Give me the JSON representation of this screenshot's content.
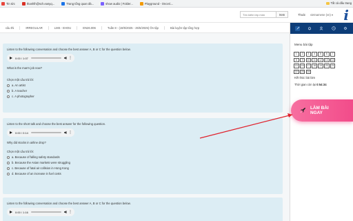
{
  "bookmarks": [
    {
      "label": "Tin tức",
      "color": "#e8453c"
    },
    {
      "label": "thanhlh@sch.easyq...",
      "color": "#d93025"
    },
    {
      "label": "Trang tổng quan đà...",
      "color": "#1a73e8"
    },
    {
      "label": "show audio | Folder...",
      "color": "#7b61ff"
    },
    {
      "label": "Playground - OnceC...",
      "color": "#f29900"
    }
  ],
  "bookmarks_right": "Tất cả dấu trang",
  "header": {
    "search_placeholder": "Tìm kiếm lớp môn",
    "search_button": "Xem",
    "logout": "Thoát",
    "user": "vietnamese (vn) ▾",
    "brand": "i"
  },
  "breadcrumb": [
    "câu thi",
    "IRREGULAR",
    "LMS - EHOU",
    "EN26.006",
    "Tuần 8 - (19/5/2025 - 25/5/2025) Ôn tập",
    "Bài luyện tập tổng hợp"
  ],
  "questions": [
    {
      "instruction": "Listen to the following conversation and choose the best answer A, B or C for the question below.",
      "audio_time": "0:00 / 1:07",
      "question": "What is the man's job now?",
      "choose_label": "Chọn một câu trả lời:",
      "options": [
        "a. An artist",
        "b. A teacher",
        "c. A photographer"
      ]
    },
    {
      "instruction": "Listen to the short talk and choose the best answer for the following question.",
      "audio_time": "0:00 / 0:14",
      "question": "Why did stocks in airline drop?",
      "choose_label": "Chọn một câu trả lời:",
      "options": [
        "a. Because of falling safety standards",
        "b. Because the Asian markets were struggling",
        "c. Because of fatal air collision in Hong Kong",
        "d. Because of an increase in fuel costs"
      ]
    },
    {
      "instruction": "Listen to the following conversation and choose the best answer A, B or C for the question below.",
      "audio_time": "0:00 / 1:16"
    }
  ],
  "sidebar": {
    "icons": [
      "rocket-icon",
      "bell-icon",
      "user-icon",
      "clock-icon",
      "gear-icon"
    ],
    "menu_title": "Menu bài tập",
    "question_numbers": [
      "1",
      "2",
      "3",
      "4",
      "5",
      "6",
      "7",
      "8",
      "9",
      "10",
      "11",
      "12",
      "13",
      "14",
      "15",
      "16",
      "17",
      "18",
      "19",
      "20",
      "21",
      "22",
      "23",
      "24"
    ],
    "finished": "Kết thúc bài làm",
    "time_label": "Thời gian còn lại",
    "time_value": "0:54:34"
  },
  "cta": {
    "label": "LÀM BÀI NGAY",
    "color": "#f24c8a"
  },
  "annotation_color": "#e0202a"
}
